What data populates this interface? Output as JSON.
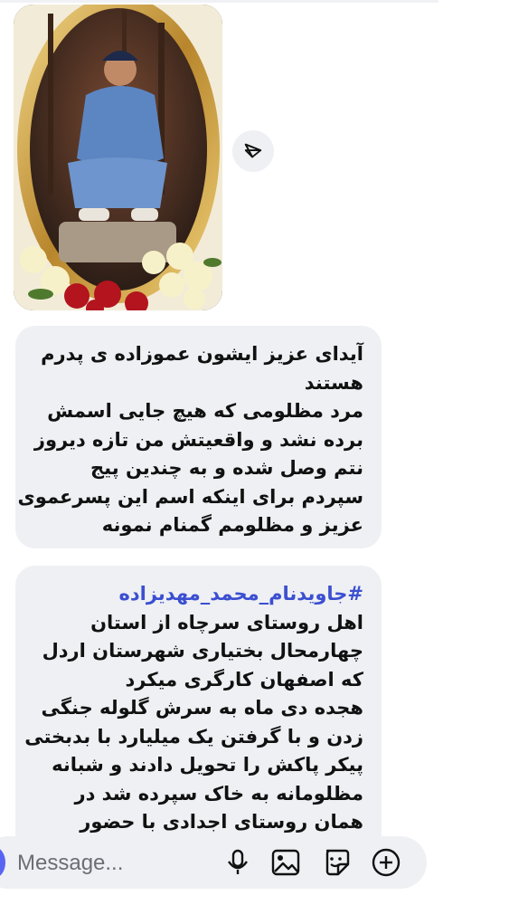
{
  "conversation": {
    "photo": {
      "icon": "portrait-photo-in-gilded-oval-frame"
    },
    "share_icon": "send-arrow-icon",
    "message_1": {
      "lines": [
        "آیدای عزیز ایشون عموزاده ی پدرم",
        "هستند",
        "مرد مظلومی که هیچ جایی اسمش",
        "برده نشد و واقعیتش من تازه دیروز",
        "نتم وصل شده و به چندین پیج",
        "سپردم برای اینکه اسم این پسرعموی",
        "عزیز و مظلومم گمنام نمونه"
      ]
    },
    "message_2": {
      "hashtag": "#جاویدنام_محمد_مهدیزاده",
      "lines": [
        "اهل روستای سرچاه از استان",
        "چهارمحال بختیاری شهرستان اردل",
        "که اصفهان کارگری میکرد",
        "هجده دی ماه به سرش گلوله جنگی",
        "زدن و با گرفتن یک میلیارد با بدبختی",
        "پیکر پاکش را تحویل دادند و شبانه",
        "مظلومانه به خاک سپرده شد در",
        "همان روستای اجدادی با حضور"
      ]
    }
  },
  "composer": {
    "placeholder": "Message...",
    "icons": [
      "microphone-icon",
      "gallery-icon",
      "sticker-icon",
      "add-icon"
    ]
  },
  "colors": {
    "bubble_bg": "#eff0f3",
    "hashtag": "#3b4fd1",
    "text": "#111111",
    "accent": "#5865f2"
  }
}
